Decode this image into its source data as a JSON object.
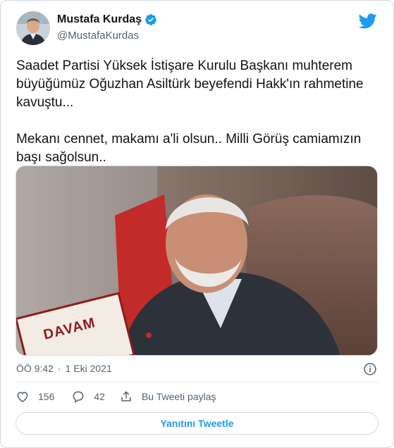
{
  "author": {
    "display_name": "Mustafa Kurdaş",
    "handle": "@MustafaKurdas",
    "avatar_icon": "user-photo",
    "verified_icon": "verified-badge-icon"
  },
  "tweet": {
    "text": "Saadet Partisi Yüksek İstişare Kurulu Başkanı muhterem büyüğümüz  Oğuzhan Asiltürk  beyefendi Hakk'ın rahmetine kavuştu...\n\nMekanı cennet, makamı a'li olsun.. Milli Görüş camiamızın başı sağolsun..",
    "media": {
      "book_title": "DAVAM"
    },
    "time": "ÖÖ 9:42",
    "separator": "·",
    "date": "1 Eki 2021"
  },
  "actions": {
    "like_count": "156",
    "reply_count": "42",
    "share_label": "Bu Tweeti paylaş"
  },
  "reply_button_label": "Yanıtını Tweetle",
  "colors": {
    "accent": "#1d9bf0",
    "text": "#0f1419",
    "muted": "#536471",
    "border": "#cfd9de"
  }
}
